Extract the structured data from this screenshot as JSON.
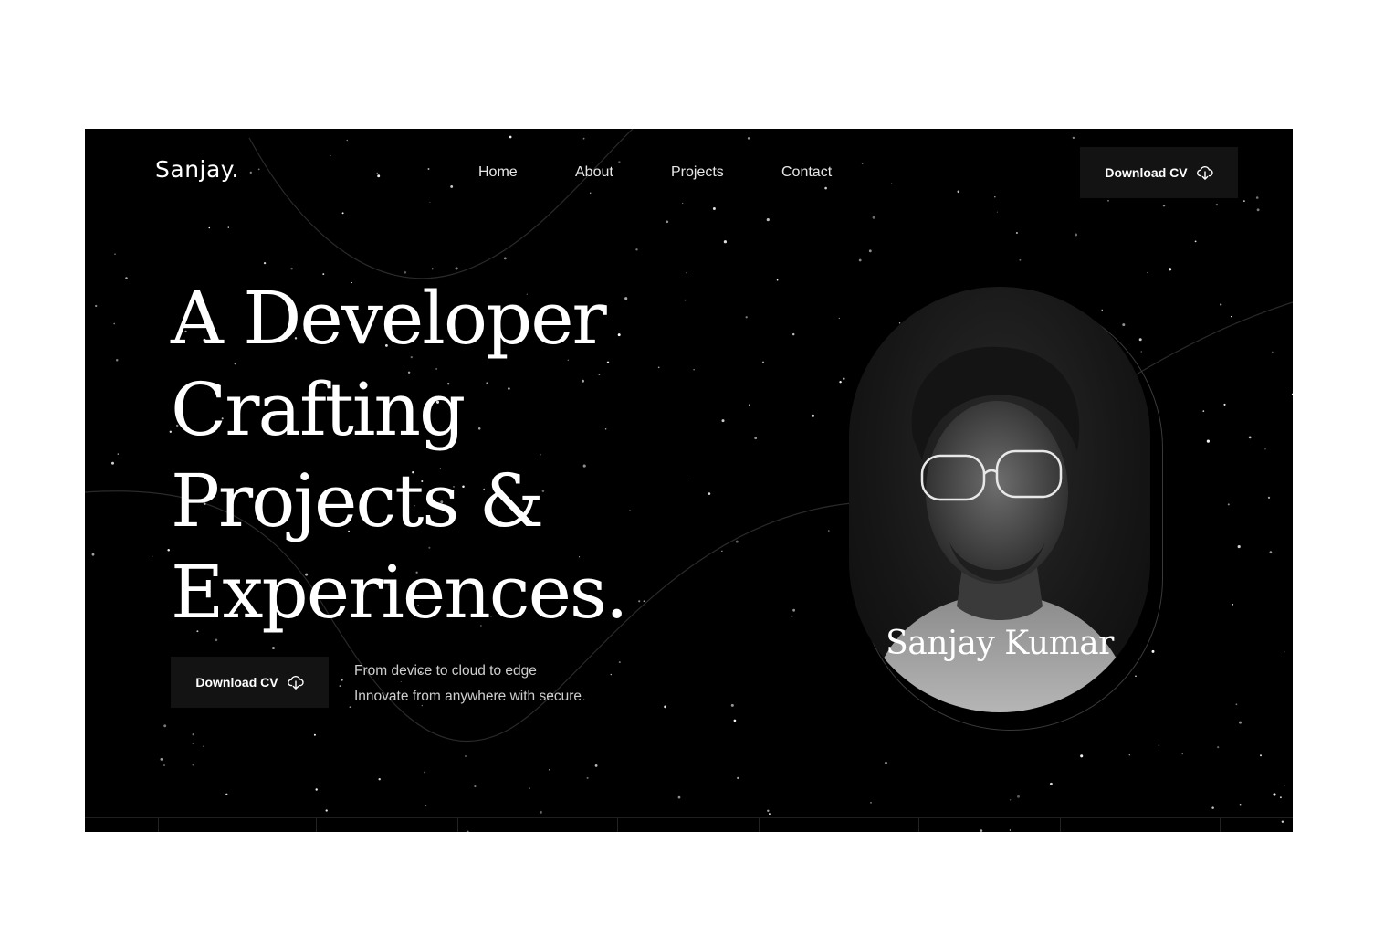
{
  "header": {
    "logo": "Sanjay.",
    "nav": [
      {
        "label": "Home"
      },
      {
        "label": "About"
      },
      {
        "label": "Projects"
      },
      {
        "label": "Contact"
      }
    ],
    "cta_label": "Download CV",
    "cta_icon": "cloud-download-icon"
  },
  "hero": {
    "headline_lines": [
      "A Developer",
      "Crafting",
      "Projects &",
      "Experiences."
    ],
    "cta_label": "Download CV",
    "cta_icon": "cloud-download-icon",
    "tagline_lines": [
      "From device to cloud to edge",
      "Innovate from anywhere with secure"
    ],
    "portrait_name": "Sanjay Kumar"
  },
  "colors": {
    "background": "#000000",
    "text": "#ffffff",
    "button": "#131313"
  }
}
